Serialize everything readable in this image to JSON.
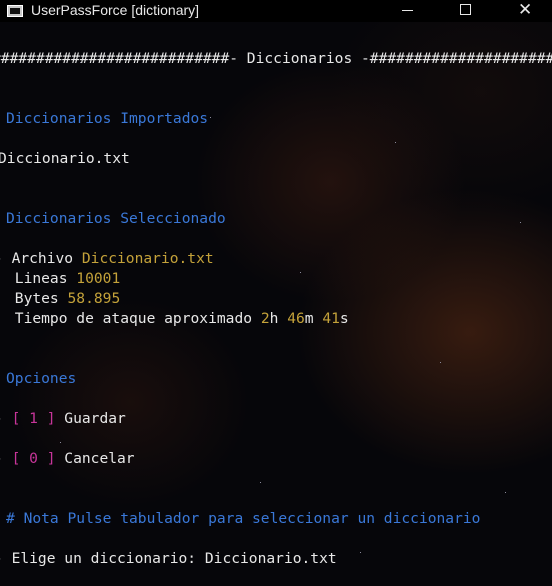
{
  "window": {
    "title": "UserPassForce [dictionary]",
    "icon": "console-icon",
    "controls": {
      "minimize": "minimize-icon",
      "maximize": "maximize-icon",
      "close": "✕"
    }
  },
  "console": {
    "header": "###########################- Diccionarios -###########################",
    "imported_heading": "Diccionarios Importados",
    "imported_file": "Diccionario.txt",
    "selected_heading": "Diccionarios Seleccionado",
    "file_prefix": "- ",
    "file_label": "Archivo ",
    "file_value": "Diccionario.txt",
    "lines_label": " Lineas ",
    "lines_value": "10001",
    "bytes_label": " Bytes ",
    "bytes_value": "58.895",
    "time_label": " Tiempo de ataque aproximado ",
    "time_h_value": "2",
    "time_h_unit": "h ",
    "time_m_value": "46",
    "time_m_unit": "m ",
    "time_s_value": "41",
    "time_s_unit": "s",
    "options_heading": "Opciones",
    "options": [
      {
        "prefix": "- ",
        "bracket": "[ 1 ]",
        "label": " Guardar"
      },
      {
        "prefix": "- ",
        "bracket": "[ 0 ]",
        "label": " Cancelar"
      }
    ],
    "note": "# Nota Pulse tabulador para seleccionar un diccionario",
    "prompt_prefix": "- ",
    "prompt_label": "Elige un diccionario: ",
    "prompt_value": "Diccionario.txt"
  },
  "colors": {
    "heading": "#3a78d8",
    "value": "#c4a23a",
    "option_bracket": "#c8359a",
    "text": "#dcdcdc",
    "background": "#06060a"
  }
}
